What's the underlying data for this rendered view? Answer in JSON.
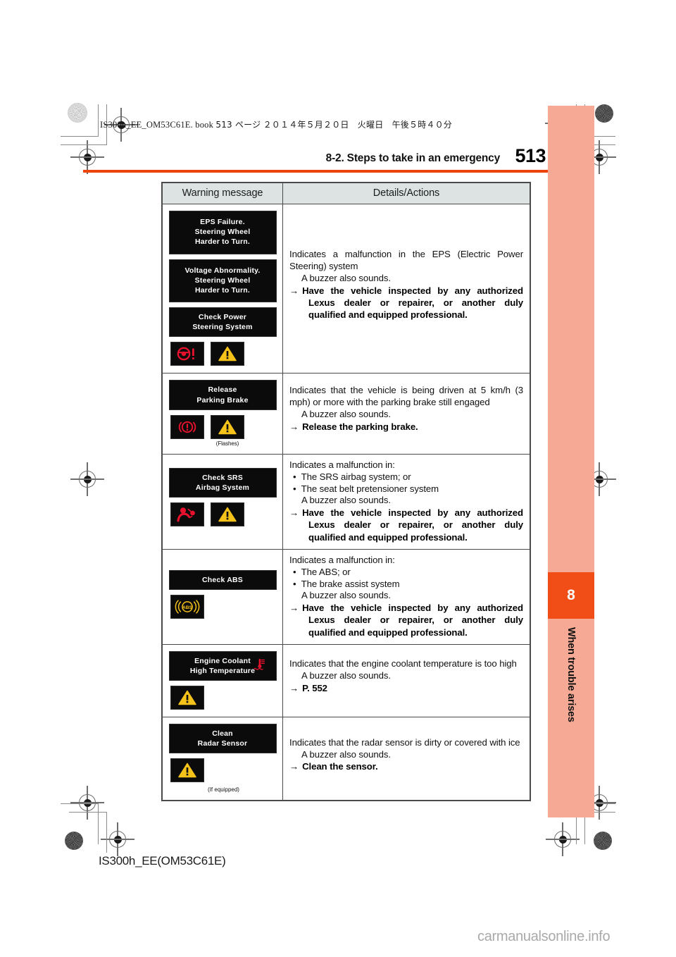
{
  "page": {
    "imprint": "IS300h_EE_OM53C61E. book",
    "imprint_page": "513 ページ",
    "imprint_date": "２０１４年５月２０日　火曜日　午後５時４０分",
    "header_title": "8-2. Steps to take in an emergency",
    "page_number": "513",
    "chapter_number": "8",
    "chapter_label": "When trouble arises",
    "footer_code": "IS300h_EE(OM53C61E)",
    "watermark": "carmanualsonline.info",
    "accent_color": "#ee4409",
    "sidebar_color": "#f6aa95",
    "chapter_box_color": "#f04e16"
  },
  "table": {
    "headers": [
      "Warning message",
      "Details/Actions"
    ],
    "rows": [
      {
        "plates": [
          "EPS Failure.\nSteering Wheel\nHarder to Turn.",
          "Voltage Abnormality.\nSteering Wheel\nHarder to Turn.",
          "Check Power\nSteering System"
        ],
        "icons": [
          "power-steering-warning-icon",
          "master-warning-triangle-icon"
        ],
        "note": "",
        "detail_lines": [
          "Indicates a malfunction in the EPS (Electric Power Steer-ing) system",
          "A buzzer also sounds."
        ],
        "detail_main": "Indicates a malfunction in the EPS (Electric Power Steering) system",
        "detail_sub": "A buzzer also sounds.",
        "action": "Have the vehicle inspected by any authorized Lexus dealer or repairer, or another duly qualified and equipped professional."
      },
      {
        "plates": [
          "Release\nParking Brake"
        ],
        "icons": [
          "brake-system-warning-icon",
          "master-warning-triangle-icon"
        ],
        "note": "(Flashes)",
        "detail_main": "Indicates that the vehicle is being driven at 5 km/h (3 mph) or more with the parking brake still engaged",
        "detail_sub": "A buzzer also sounds.",
        "action": "Release the parking brake."
      },
      {
        "plates": [
          "Check SRS\nAirbag System"
        ],
        "icons": [
          "srs-airbag-warning-icon",
          "master-warning-triangle-icon"
        ],
        "note": "",
        "detail_main": "Indicates a malfunction in:",
        "bullets": [
          "The SRS airbag system; or",
          "The seat belt pretensioner system"
        ],
        "detail_sub": "A buzzer also sounds.",
        "action": "Have the vehicle inspected by any authorized Lexus dealer or repairer, or another duly qualified and equipped professional."
      },
      {
        "plates": [
          "Check ABS"
        ],
        "icons": [
          "abs-warning-icon"
        ],
        "note": "",
        "detail_main": "Indicates a malfunction in:",
        "bullets": [
          "The ABS; or",
          "The brake assist system"
        ],
        "detail_sub": "A buzzer also sounds.",
        "action": "Have the vehicle inspected by any authorized Lexus dealer or repairer, or another duly qualified and equipped professional."
      },
      {
        "plates": [
          "Engine Coolant\nHigh Temperature"
        ],
        "plate_icon": "engine-coolant-temperature-icon",
        "icons": [
          "master-warning-triangle-icon"
        ],
        "note": "",
        "detail_main": "Indicates that the engine coolant temperature is too high",
        "detail_sub": "A buzzer also sounds.",
        "action": "P. 552"
      },
      {
        "plates": [
          "Clean\nRadar Sensor"
        ],
        "icons": [
          "master-warning-triangle-icon"
        ],
        "note": "(If equipped)",
        "detail_main": "Indicates that the radar sensor is dirty or covered with ice",
        "detail_sub": "A buzzer also sounds.",
        "action": "Clean the sensor."
      }
    ]
  },
  "symbols": {
    "arrow": "→",
    "bullet": "•"
  }
}
